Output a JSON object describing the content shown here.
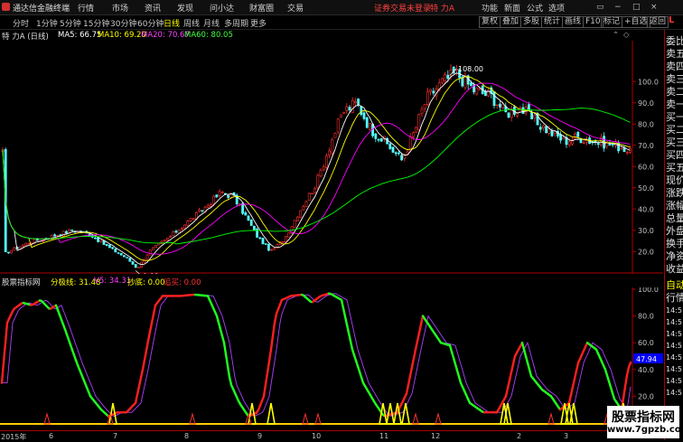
{
  "window": {
    "app_title": "通达信金融终端",
    "menus": [
      "行情",
      "市场",
      "资讯",
      "发现",
      "问小达",
      "财富圈",
      "交易"
    ],
    "status_text": "证券交易未登录",
    "stock_name": "特 力A",
    "top_right": [
      "功能",
      "新面",
      "公式",
      "选项"
    ],
    "window_controls": [
      "▭",
      "−",
      "□",
      "×"
    ]
  },
  "toolbar": {
    "periods": [
      "分时",
      "1分钟",
      "5分钟",
      "15分钟",
      "30分钟",
      "60分钟",
      "日线",
      "周线",
      "月线",
      "多周期",
      "更多"
    ],
    "active_period": "日线",
    "right_buttons": [
      "复权",
      "叠加",
      "多股",
      "统计",
      "画线",
      "F10",
      "标记",
      "+自选",
      "返回"
    ]
  },
  "main_chart": {
    "title": "特 力A (日线)",
    "ma5_label": "MA5: 66.75",
    "ma10_label": "MA10: 69.20",
    "ma20_label": "MA20: 70.67",
    "ma60_label": "MA60: 80.05",
    "high_annotation": "108.00",
    "low_annotation": "9.88",
    "price_ticks": [
      "100.0",
      "90.0",
      "80.0",
      "70.0",
      "60.0",
      "50.0",
      "40.0",
      "30.0",
      "20.0"
    ],
    "colors": {
      "ma5": "#ffffff",
      "ma10": "#ffff00",
      "ma20": "#ff00ff",
      "ma60": "#00ff00",
      "up": "#ff3030",
      "down": "#54ffff"
    }
  },
  "indicator": {
    "name": "股票指标网",
    "fenji_label": "分极线: 31.48",
    "v5_label": "V5: 34.31",
    "chaodi_label": "抄底: 0.00",
    "zhuimai_label": "追买: 0.00",
    "current_value": "47.94",
    "ticks": [
      "100.0",
      "80.0",
      "60.0",
      "40.0",
      "20.0"
    ]
  },
  "x_axis": [
    "2015年",
    "6",
    "7",
    "8",
    "9",
    "10",
    "11",
    "12",
    "2",
    "3"
  ],
  "right_panel": {
    "badge": "L",
    "items": [
      "委比",
      "卖五",
      "卖四",
      "卖三",
      "卖二",
      "卖一",
      "买一",
      "买二",
      "买三",
      "买四",
      "买五",
      "现价",
      "涨跌",
      "涨幅",
      "总量",
      "外盘",
      "换手",
      "净资",
      "收益",
      "自动",
      "行情"
    ],
    "times": [
      "14:5",
      "14:5",
      "14:5",
      "14:5",
      "14:5",
      "14:5",
      "14:5",
      "14:5"
    ]
  },
  "watermark": {
    "line1": "股票指标网",
    "line2": "www.7gpzb.com"
  }
}
